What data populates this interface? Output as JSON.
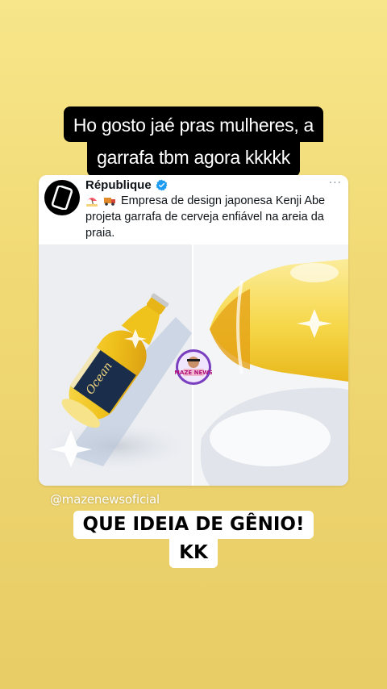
{
  "overlay": {
    "top_caption_line1": "Ho gosto jaé  pras mulheres, a",
    "top_caption_line2": "garrafa tbm agora kkkkk",
    "handle": "@mazenewsoficial",
    "bottom_caption_line1": "QUE IDEIA DE GÊNIO!",
    "bottom_caption_line2": "KK"
  },
  "tweet": {
    "author": "République",
    "verified_icon": "verified-badge-icon",
    "more_icon": "more-dots-icon",
    "more_label": "···",
    "text": "Empresa de design japonesa Kenji Abe projeta garrafa de cerveja enfiável na areia da praia.",
    "emojis": [
      "beach-umbrella-icon",
      "moving-truck-icon"
    ]
  },
  "media": {
    "left_image": "beer-bottle-lying-diagonal",
    "right_image": "beer-bottle-closeup",
    "label_text": "Ocean"
  },
  "watermark": {
    "icon": "maze-news-logo",
    "label": "MAZE NEWS"
  },
  "colors": {
    "background": "#f0d872",
    "verified": "#1d9bf0",
    "bottle": "#f2c318"
  }
}
